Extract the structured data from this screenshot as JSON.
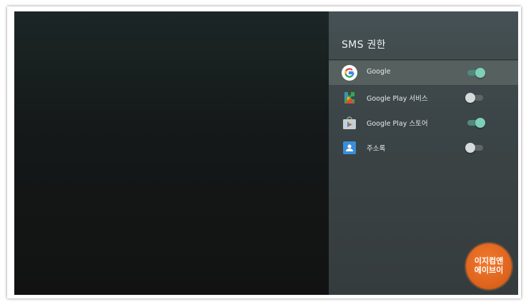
{
  "panel": {
    "title": "SMS 권한",
    "items": [
      {
        "label": "Google",
        "icon": "google-icon",
        "enabled": true,
        "selected": true
      },
      {
        "label": "Google Play 서비스",
        "icon": "google-play-services-icon",
        "enabled": false,
        "selected": false
      },
      {
        "label": "Google Play 스토어",
        "icon": "google-play-store-icon",
        "enabled": true,
        "selected": false
      },
      {
        "label": "주소록",
        "icon": "contacts-icon",
        "enabled": false,
        "selected": false
      }
    ]
  },
  "watermark": {
    "line1": "이지컴앤",
    "line2": "에이브이"
  },
  "colors": {
    "switch_on_thumb": "#7fcfb7",
    "switch_on_track": "#4f8a7c",
    "switch_off_thumb": "#d6dada",
    "panel_bg": "#3b4446",
    "selected_row_bg": "#55605f",
    "watermark_orange": "#e0651e"
  }
}
